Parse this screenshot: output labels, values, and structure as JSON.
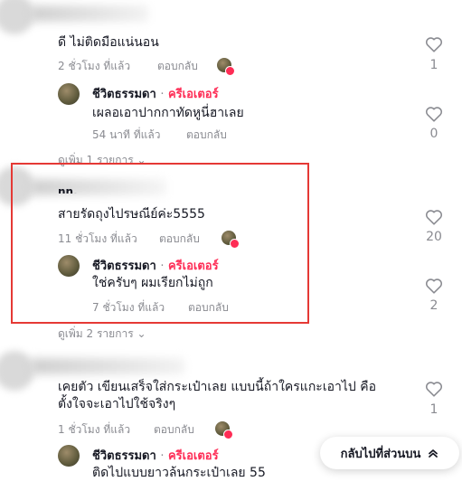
{
  "comments": [
    {
      "text": "ดี ไม่ติดมือแน่นอน",
      "time": "2 ชั่วโมง ที่แล้ว",
      "reply_label": "ตอบกลับ",
      "likes": "1"
    },
    {
      "text": "สายรัดถุงไปรษณีย์ค่ะ5555",
      "time": "11 ชั่วโมง ที่แล้ว",
      "reply_label": "ตอบกลับ",
      "likes": "20"
    },
    {
      "text_line1": "เคยตัว เขียนเสร็จใส่กระเป๋าเลย แบบนี้ถ้าใครแกะเอาไป คือ",
      "text_line2": "ตั้งใจจะเอาไปใช้จริงๆ",
      "time": "1 ชั่วโมง ที่แล้ว",
      "reply_label": "ตอบกลับ",
      "likes": "1"
    }
  ],
  "replies": [
    {
      "author": "ชีวิตธรรมดา",
      "separator": "·",
      "creator_label": "ครีเอเตอร์",
      "text": "เผลอเอาปากกาทัดหูนี่ฮาเลย",
      "time": "54 นาที ที่แล้ว",
      "reply_label": "ตอบกลับ",
      "likes": "0"
    },
    {
      "author": "ชีวิตธรรมดา",
      "separator": "·",
      "creator_label": "ครีเอเตอร์",
      "text": "ใช่ครับๆ ผมเรียกไม่ถูก",
      "time": "7 ชั่วโมง ที่แล้ว",
      "reply_label": "ตอบกลับ",
      "likes": "2"
    },
    {
      "author": "ชีวิตธรรมดา",
      "separator": "·",
      "creator_label": "ครีเอเตอร์",
      "text": "ติดไปแบบยาวล้นกระเป๋าเลย 55"
    }
  ],
  "view_more": [
    {
      "label": "ดูเพิ่ม 1 รายการ"
    },
    {
      "label": "ดูเพิ่ม 2 รายการ"
    }
  ],
  "back_to_top": {
    "label": "กลับไปที่ส่วนบน"
  },
  "partial_author": "nn,",
  "colors": {
    "creator": "#fe2c55",
    "highlight": "#e53935",
    "meta": "#8a8b91"
  }
}
